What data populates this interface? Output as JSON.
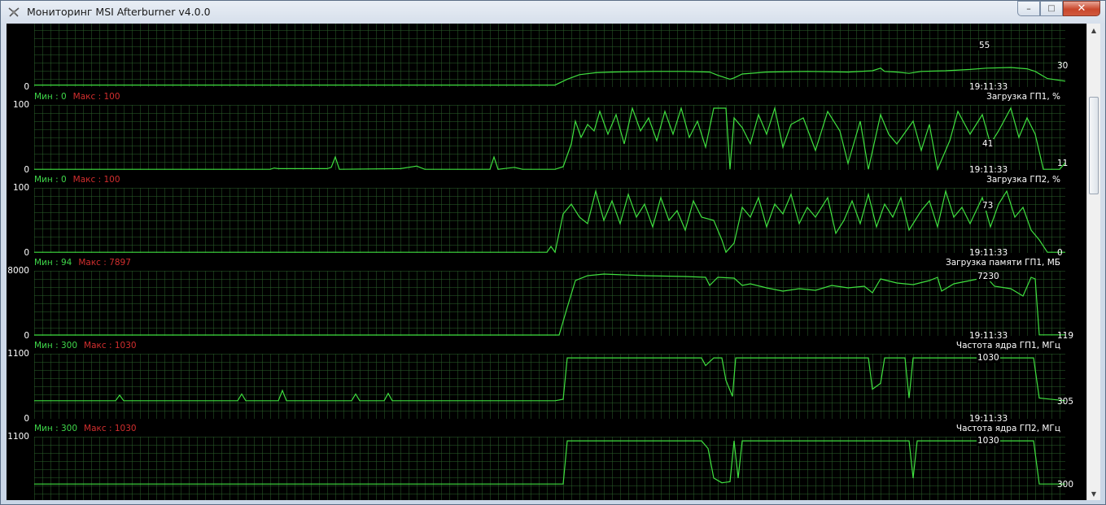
{
  "window": {
    "title": "Мониторинг MSI Afterburner v4.0.0",
    "min_glyph": "–",
    "max_glyph": "□",
    "close_glyph": "✕"
  },
  "colors": {
    "line": "#3fe03f",
    "grid": "#254f25",
    "min_text": "#3fd84a",
    "max_text": "#d22e2e"
  },
  "scrollbar": {
    "up_glyph": "▲",
    "down_glyph": "▼"
  },
  "graphs": [
    {
      "id": "top",
      "y_max": "100",
      "y_min": "0",
      "current": "30",
      "peak_label": "55",
      "time": "19:11:33",
      "stats_min": "Мин : 0",
      "stats_max": "Макс : 100",
      "name": "Загрузка ГП1, %",
      "range": [
        0,
        100
      ],
      "trace": [
        [
          0,
          3
        ],
        [
          640,
          3
        ],
        [
          655,
          12
        ],
        [
          670,
          19
        ],
        [
          690,
          22
        ],
        [
          710,
          23
        ],
        [
          760,
          24
        ],
        [
          800,
          24
        ],
        [
          830,
          23
        ],
        [
          840,
          18
        ],
        [
          855,
          12
        ],
        [
          860,
          14
        ],
        [
          870,
          20
        ],
        [
          900,
          23
        ],
        [
          950,
          24
        ],
        [
          1000,
          23
        ],
        [
          1030,
          25
        ],
        [
          1040,
          29
        ],
        [
          1045,
          24
        ],
        [
          1060,
          23
        ],
        [
          1075,
          21
        ],
        [
          1090,
          24
        ],
        [
          1120,
          25
        ],
        [
          1150,
          27
        ],
        [
          1170,
          29
        ],
        [
          1200,
          30
        ],
        [
          1220,
          28
        ],
        [
          1230,
          24
        ],
        [
          1245,
          13
        ],
        [
          1267,
          9
        ]
      ]
    },
    {
      "id": "gpu1-load",
      "y_max": "100",
      "y_min": "0",
      "current": "11",
      "peak_label": "41",
      "time": "19:11:33",
      "stats_min": "Мин : 0",
      "stats_max": "Макс : 100",
      "name": "Загрузка ГП2, %",
      "range": [
        0,
        100
      ],
      "trace": [
        [
          0,
          1
        ],
        [
          290,
          1
        ],
        [
          295,
          3
        ],
        [
          300,
          2
        ],
        [
          360,
          2
        ],
        [
          365,
          4
        ],
        [
          370,
          20
        ],
        [
          375,
          1
        ],
        [
          450,
          2
        ],
        [
          470,
          6
        ],
        [
          480,
          1
        ],
        [
          560,
          1
        ],
        [
          565,
          20
        ],
        [
          570,
          1
        ],
        [
          590,
          4
        ],
        [
          600,
          1
        ],
        [
          640,
          1
        ],
        [
          650,
          5
        ],
        [
          660,
          40
        ],
        [
          665,
          75
        ],
        [
          672,
          50
        ],
        [
          680,
          70
        ],
        [
          688,
          60
        ],
        [
          695,
          90
        ],
        [
          705,
          55
        ],
        [
          715,
          85
        ],
        [
          725,
          40
        ],
        [
          735,
          95
        ],
        [
          745,
          60
        ],
        [
          755,
          80
        ],
        [
          765,
          45
        ],
        [
          775,
          90
        ],
        [
          785,
          55
        ],
        [
          795,
          95
        ],
        [
          805,
          50
        ],
        [
          815,
          75
        ],
        [
          825,
          35
        ],
        [
          835,
          95
        ],
        [
          850,
          95
        ],
        [
          855,
          1
        ],
        [
          860,
          80
        ],
        [
          870,
          65
        ],
        [
          880,
          40
        ],
        [
          890,
          85
        ],
        [
          900,
          55
        ],
        [
          910,
          95
        ],
        [
          920,
          35
        ],
        [
          930,
          70
        ],
        [
          945,
          80
        ],
        [
          960,
          30
        ],
        [
          975,
          90
        ],
        [
          990,
          60
        ],
        [
          1000,
          10
        ],
        [
          1015,
          75
        ],
        [
          1025,
          1
        ],
        [
          1040,
          85
        ],
        [
          1050,
          55
        ],
        [
          1060,
          40
        ],
        [
          1080,
          75
        ],
        [
          1090,
          30
        ],
        [
          1100,
          70
        ],
        [
          1110,
          1
        ],
        [
          1125,
          45
        ],
        [
          1135,
          90
        ],
        [
          1150,
          55
        ],
        [
          1165,
          85
        ],
        [
          1175,
          40
        ],
        [
          1185,
          60
        ],
        [
          1200,
          95
        ],
        [
          1210,
          50
        ],
        [
          1220,
          80
        ],
        [
          1230,
          55
        ],
        [
          1240,
          1
        ],
        [
          1260,
          1
        ],
        [
          1267,
          11
        ]
      ]
    },
    {
      "id": "gpu2-load",
      "y_max": "100",
      "y_min": "0",
      "current": "0",
      "peak_label": "73",
      "time": "19:11:33",
      "stats_min": "Мин : 94",
      "stats_max": "Макс : 7897",
      "name": "Загрузка памяти ГП1, МБ",
      "range": [
        0,
        100
      ],
      "trace": [
        [
          0,
          1
        ],
        [
          630,
          1
        ],
        [
          635,
          10
        ],
        [
          640,
          1
        ],
        [
          650,
          60
        ],
        [
          660,
          75
        ],
        [
          670,
          55
        ],
        [
          680,
          45
        ],
        [
          690,
          95
        ],
        [
          700,
          50
        ],
        [
          710,
          80
        ],
        [
          720,
          45
        ],
        [
          730,
          90
        ],
        [
          740,
          55
        ],
        [
          750,
          75
        ],
        [
          760,
          40
        ],
        [
          770,
          85
        ],
        [
          780,
          50
        ],
        [
          790,
          65
        ],
        [
          800,
          35
        ],
        [
          810,
          80
        ],
        [
          820,
          55
        ],
        [
          835,
          50
        ],
        [
          845,
          20
        ],
        [
          850,
          1
        ],
        [
          860,
          15
        ],
        [
          870,
          70
        ],
        [
          880,
          55
        ],
        [
          890,
          85
        ],
        [
          900,
          40
        ],
        [
          910,
          75
        ],
        [
          920,
          60
        ],
        [
          930,
          90
        ],
        [
          940,
          45
        ],
        [
          950,
          70
        ],
        [
          960,
          55
        ],
        [
          975,
          85
        ],
        [
          985,
          30
        ],
        [
          995,
          50
        ],
        [
          1005,
          80
        ],
        [
          1015,
          45
        ],
        [
          1025,
          90
        ],
        [
          1035,
          40
        ],
        [
          1045,
          75
        ],
        [
          1055,
          55
        ],
        [
          1065,
          85
        ],
        [
          1075,
          35
        ],
        [
          1090,
          65
        ],
        [
          1100,
          80
        ],
        [
          1110,
          40
        ],
        [
          1120,
          95
        ],
        [
          1130,
          55
        ],
        [
          1140,
          70
        ],
        [
          1150,
          45
        ],
        [
          1165,
          85
        ],
        [
          1175,
          40
        ],
        [
          1185,
          75
        ],
        [
          1195,
          95
        ],
        [
          1205,
          55
        ],
        [
          1215,
          70
        ],
        [
          1225,
          35
        ],
        [
          1235,
          20
        ],
        [
          1245,
          1
        ],
        [
          1267,
          1
        ]
      ]
    },
    {
      "id": "gpu1-mem",
      "y_max": "8000",
      "y_min": "0",
      "current": "119",
      "peak_label": "7230",
      "time": "19:11:33",
      "stats_min": "Мин : 300",
      "stats_max": "Макс : 1030",
      "name": "Частота ядра ГП1, МГц",
      "range": [
        0,
        8000
      ],
      "trace": [
        [
          0,
          100
        ],
        [
          645,
          100
        ],
        [
          655,
          3500
        ],
        [
          665,
          6800
        ],
        [
          680,
          7400
        ],
        [
          700,
          7600
        ],
        [
          750,
          7400
        ],
        [
          800,
          7300
        ],
        [
          825,
          7200
        ],
        [
          830,
          6200
        ],
        [
          840,
          7200
        ],
        [
          860,
          7100
        ],
        [
          870,
          6200
        ],
        [
          880,
          6400
        ],
        [
          900,
          5900
        ],
        [
          920,
          5500
        ],
        [
          940,
          5800
        ],
        [
          960,
          5600
        ],
        [
          980,
          6200
        ],
        [
          1000,
          5900
        ],
        [
          1020,
          6100
        ],
        [
          1030,
          5300
        ],
        [
          1040,
          7000
        ],
        [
          1060,
          6500
        ],
        [
          1080,
          6300
        ],
        [
          1100,
          6800
        ],
        [
          1110,
          7200
        ],
        [
          1115,
          5500
        ],
        [
          1130,
          6400
        ],
        [
          1150,
          6800
        ],
        [
          1170,
          7200
        ],
        [
          1180,
          6100
        ],
        [
          1200,
          5800
        ],
        [
          1215,
          4900
        ],
        [
          1225,
          7200
        ],
        [
          1230,
          7000
        ],
        [
          1235,
          120
        ],
        [
          1267,
          119
        ]
      ]
    },
    {
      "id": "gpu1-core",
      "y_max": "1100",
      "y_min": "0",
      "current": "305",
      "peak_label": "1030",
      "time": "19:11:33",
      "stats_min": "Мин : 300",
      "stats_max": "Макс : 1030",
      "name": "Частота ядра ГП2, МГц",
      "range": [
        0,
        1100
      ],
      "trace": [
        [
          0,
          305
        ],
        [
          100,
          305
        ],
        [
          105,
          400
        ],
        [
          110,
          305
        ],
        [
          250,
          305
        ],
        [
          255,
          420
        ],
        [
          260,
          305
        ],
        [
          300,
          305
        ],
        [
          305,
          480
        ],
        [
          310,
          305
        ],
        [
          390,
          305
        ],
        [
          395,
          420
        ],
        [
          400,
          305
        ],
        [
          430,
          305
        ],
        [
          435,
          430
        ],
        [
          440,
          305
        ],
        [
          640,
          305
        ],
        [
          650,
          330
        ],
        [
          655,
          1030
        ],
        [
          820,
          1030
        ],
        [
          825,
          900
        ],
        [
          835,
          1030
        ],
        [
          845,
          1030
        ],
        [
          850,
          650
        ],
        [
          858,
          380
        ],
        [
          862,
          1030
        ],
        [
          1025,
          1030
        ],
        [
          1030,
          500
        ],
        [
          1040,
          600
        ],
        [
          1045,
          1030
        ],
        [
          1070,
          1030
        ],
        [
          1075,
          350
        ],
        [
          1080,
          1030
        ],
        [
          1228,
          1030
        ],
        [
          1235,
          350
        ],
        [
          1267,
          305
        ]
      ]
    },
    {
      "id": "gpu2-core",
      "y_max": "1100",
      "y_min": "0",
      "current": "300",
      "peak_label": "1030",
      "time": "",
      "stats_min": "",
      "stats_max": "",
      "name": "",
      "range": [
        0,
        1100
      ],
      "trace": [
        [
          0,
          300
        ],
        [
          650,
          300
        ],
        [
          655,
          1030
        ],
        [
          820,
          1030
        ],
        [
          828,
          900
        ],
        [
          835,
          400
        ],
        [
          845,
          320
        ],
        [
          855,
          340
        ],
        [
          860,
          1030
        ],
        [
          865,
          400
        ],
        [
          870,
          1030
        ],
        [
          1075,
          1030
        ],
        [
          1080,
          400
        ],
        [
          1085,
          1030
        ],
        [
          1228,
          1030
        ],
        [
          1235,
          300
        ],
        [
          1267,
          300
        ]
      ]
    }
  ]
}
